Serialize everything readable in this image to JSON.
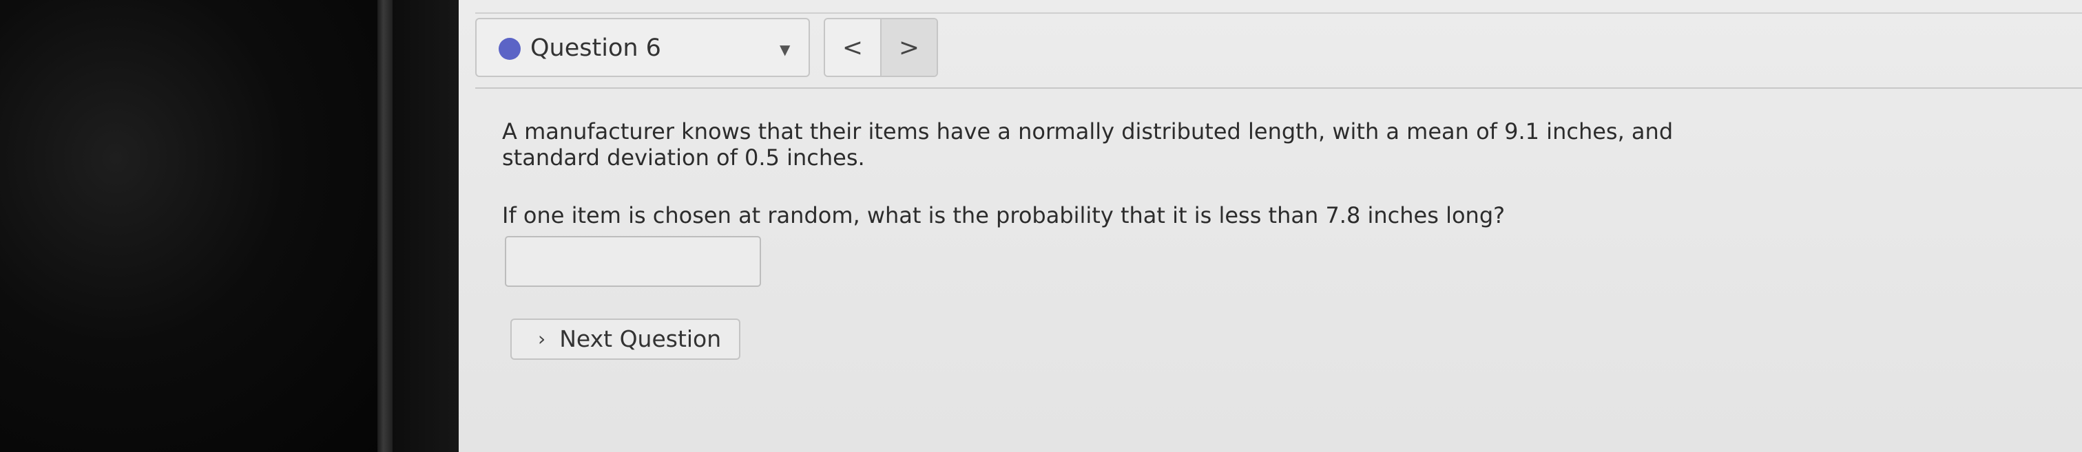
{
  "question_nav": {
    "status_color": "#5b64c6",
    "selector_label": "Question 6",
    "selector_caret": "▼",
    "prev_symbol": "<",
    "next_symbol": ">"
  },
  "problem": {
    "paragraph_1": "A manufacturer knows that their items have a normally distributed length, with a mean of 9.1 inches, and standard deviation of 0.5 inches.",
    "paragraph_2": "If one item is chosen at random, what is the probability that it is less than 7.8 inches long?"
  },
  "answer_input": {
    "value": "",
    "placeholder": ""
  },
  "next_question": {
    "chevron": "›",
    "label": "Next Question"
  }
}
